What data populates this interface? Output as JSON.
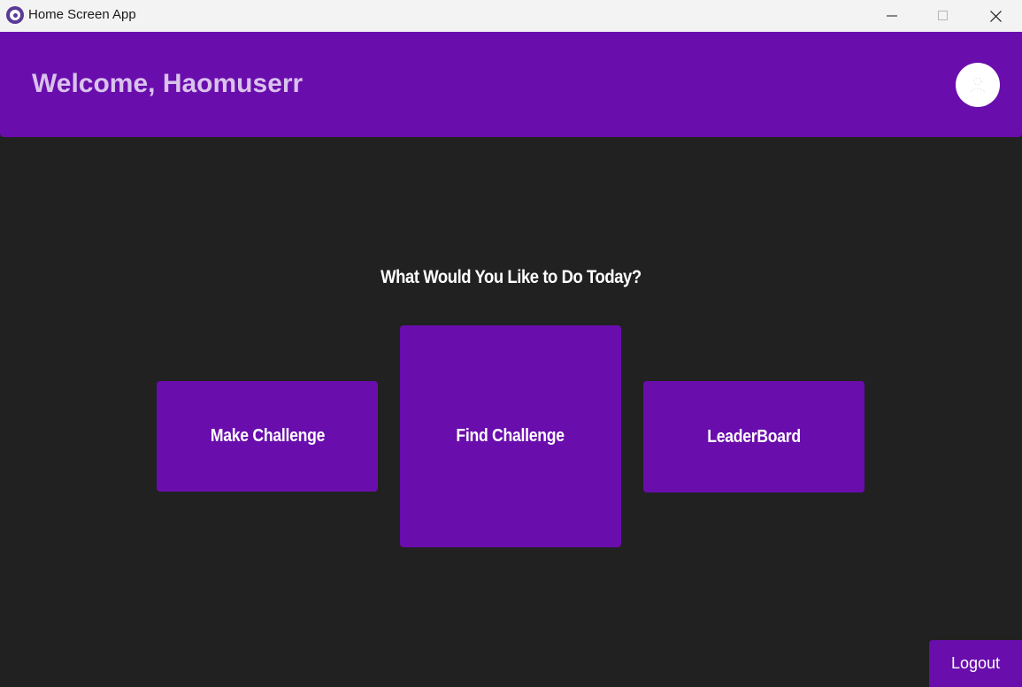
{
  "window": {
    "title": "Home Screen App",
    "icon": "app-logo-icon",
    "controls": [
      "minimize-icon",
      "maximize-icon",
      "close-icon"
    ]
  },
  "header": {
    "welcome_text": "Welcome, Haomuserr",
    "avatar": "user-avatar"
  },
  "main": {
    "prompt": "What Would You Like to Do Today?",
    "cards": [
      {
        "label": "Make Challenge"
      },
      {
        "label": "Find Challenge"
      },
      {
        "label": "LeaderBoard"
      }
    ]
  },
  "footer": {
    "logout_label": "Logout"
  },
  "colors": {
    "accent": "#6a0dad",
    "background": "#212121",
    "titlebar": "#f3f3f3",
    "welcome_text": "#d9c2ec"
  }
}
